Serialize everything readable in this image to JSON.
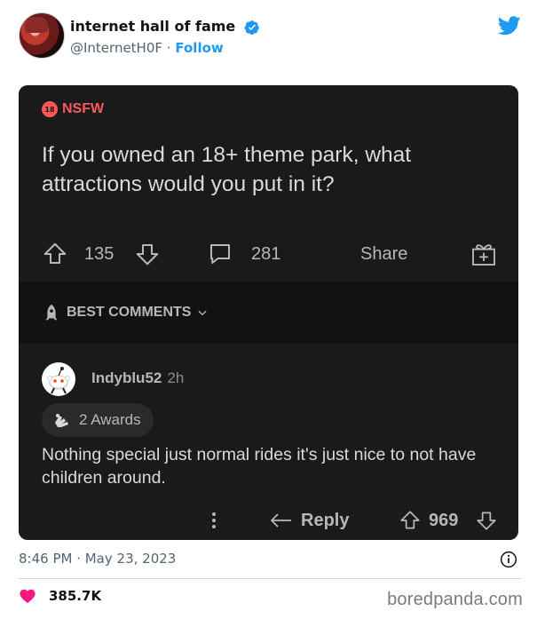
{
  "tweet": {
    "author_name": "internet hall of fame",
    "handle": "@InternetH0F",
    "separator": "·",
    "follow_label": "Follow",
    "timestamp": "8:46 PM · May 23, 2023",
    "likes": "385.7K"
  },
  "post": {
    "nsfw_badge": "18",
    "nsfw_label": "NSFW",
    "title": "If you owned an 18+ theme park, what attractions would you put in it?",
    "upvotes": "135",
    "comments": "281",
    "share_label": "Share",
    "sort_label": "BEST COMMENTS"
  },
  "comment": {
    "username": "Indyblu52",
    "age": "2h",
    "awards": "2 Awards",
    "body": "Nothing special just normal rides it's just nice to not have children around.",
    "reply_label": "Reply",
    "votes": "969"
  },
  "watermark": "boredpanda.com",
  "colors": {
    "twitter_blue": "#1d9bf0",
    "card_bg": "#1a1a1b",
    "nsfw_red": "#ff585b",
    "like_pink": "#f91880"
  },
  "icons": [
    "verified-badge-icon",
    "twitter-bird-icon",
    "upvote-arrow-icon",
    "downvote-arrow-icon",
    "comment-bubble-icon",
    "gift-icon",
    "rocket-icon",
    "chevron-down-icon",
    "award-icon",
    "more-dots-icon",
    "reply-arrow-icon",
    "info-icon",
    "heart-icon"
  ]
}
